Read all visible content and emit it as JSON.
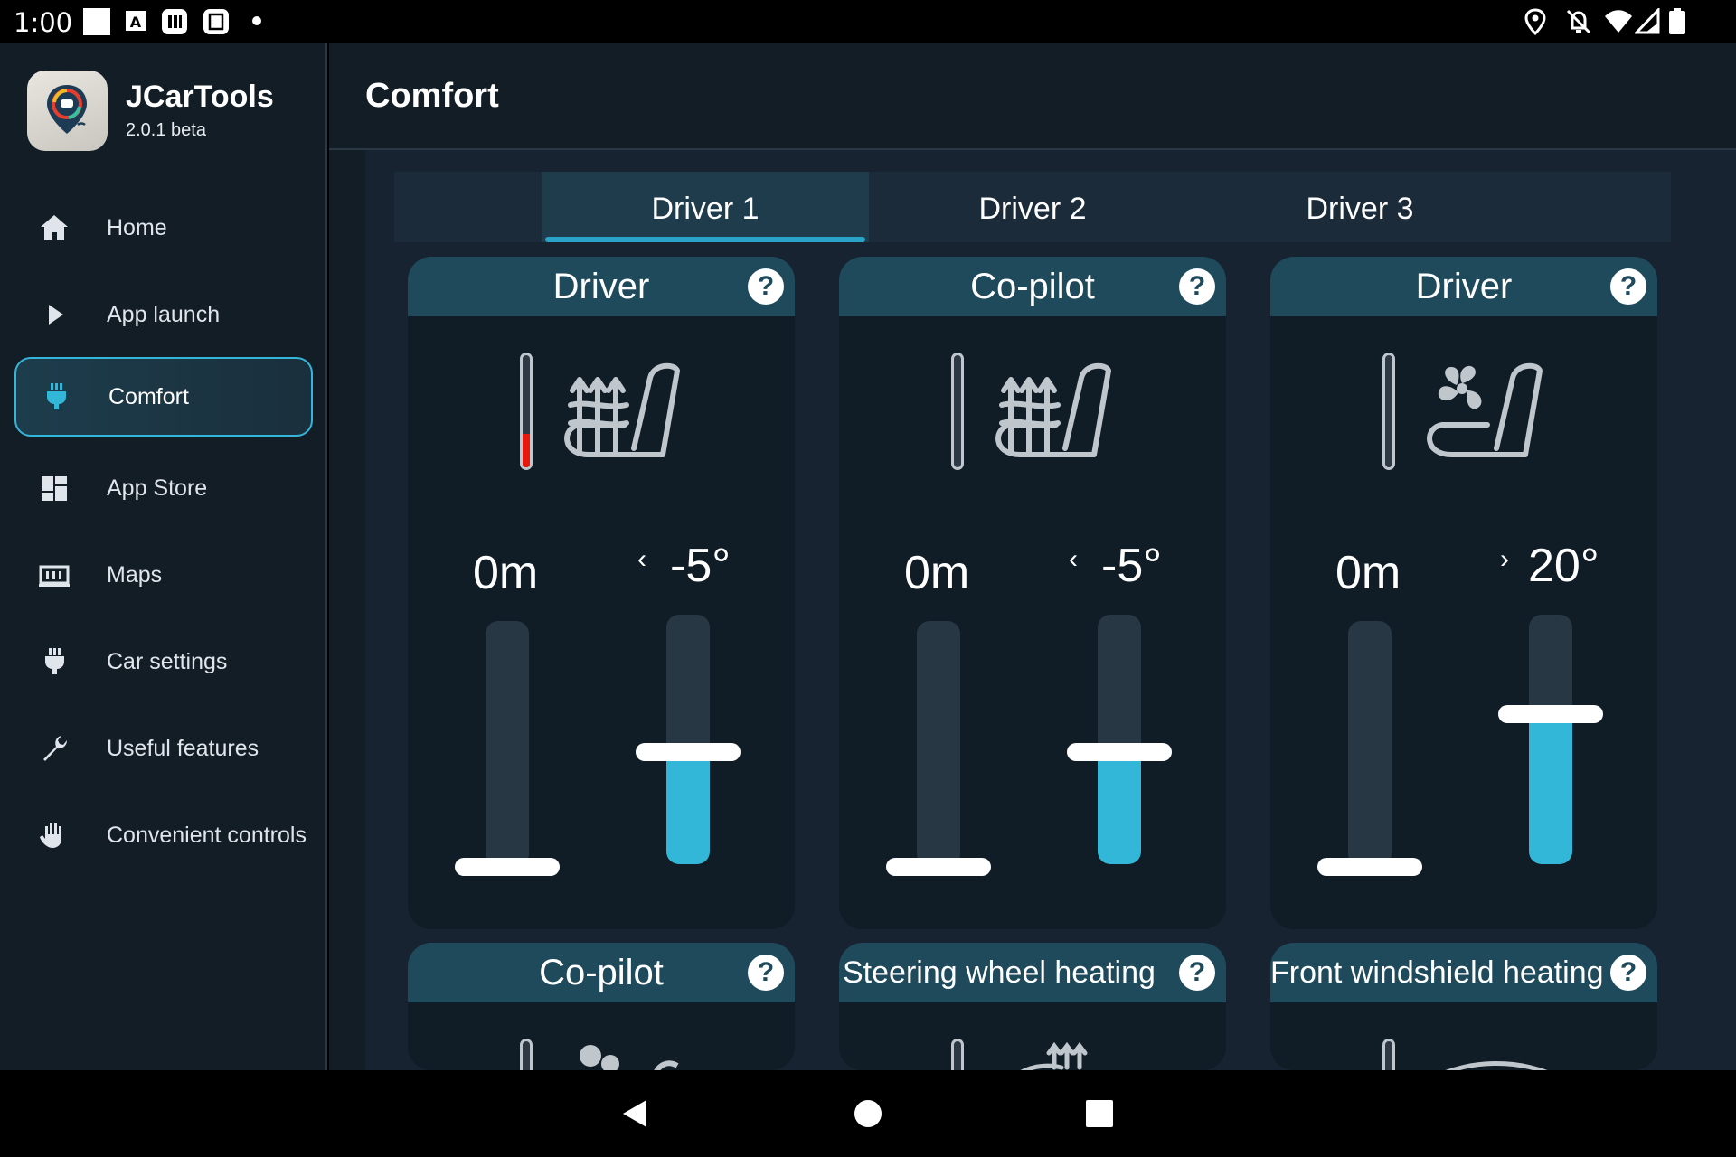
{
  "status_bar": {
    "time": "1:00",
    "left_icons": [
      "notification-square-icon",
      "keyboard-a-icon",
      "app-badge-icon",
      "app-badge-2-icon",
      "dot-icon"
    ],
    "right_icons": [
      "location-icon",
      "notifications-off-icon",
      "wifi-icon",
      "signal-icon",
      "battery-icon"
    ]
  },
  "app": {
    "name": "JCarTools",
    "version": "2.0.1 beta"
  },
  "sidebar": {
    "items": [
      {
        "label": "Home",
        "icon": "home-icon",
        "active": false
      },
      {
        "label": "App launch",
        "icon": "play-icon",
        "active": false
      },
      {
        "label": "Comfort",
        "icon": "seat-plug-icon",
        "active": true
      },
      {
        "label": "App Store",
        "icon": "dashboard-icon",
        "active": false
      },
      {
        "label": "Maps",
        "icon": "map-icon",
        "active": false
      },
      {
        "label": "Car settings",
        "icon": "plug-icon",
        "active": false
      },
      {
        "label": "Useful features",
        "icon": "wrench-icon",
        "active": false
      },
      {
        "label": "Convenient controls",
        "icon": "hand-icon",
        "active": false
      }
    ]
  },
  "header": {
    "title": "Comfort"
  },
  "tabs": [
    {
      "label": "Driver 1",
      "active": true
    },
    {
      "label": "Driver 2",
      "active": false
    },
    {
      "label": "Driver 3",
      "active": false
    }
  ],
  "cards": [
    {
      "title": "Driver",
      "help": "?",
      "icon": "seat-heating-icon",
      "thermo_level": 0.3,
      "timer": "0m",
      "temp": "-5°",
      "chevron": "‹",
      "timer_level": 0.0,
      "temp_level": 0.45
    },
    {
      "title": "Co-pilot",
      "help": "?",
      "icon": "seat-heating-icon",
      "thermo_level": 0.0,
      "timer": "0m",
      "temp": "-5°",
      "chevron": "‹",
      "timer_level": 0.0,
      "temp_level": 0.45
    },
    {
      "title": "Driver",
      "help": "?",
      "icon": "seat-ventilation-icon",
      "thermo_level": 0.0,
      "timer": "0m",
      "temp": "20°",
      "chevron": "›",
      "timer_level": 0.0,
      "temp_level": 0.6
    }
  ],
  "cards_row2": [
    {
      "title": "Co-pilot",
      "help": "?",
      "icon": "seat-ventilation-icon"
    },
    {
      "title": "Steering wheel heating",
      "help": "?",
      "icon": "steering-heating-icon"
    },
    {
      "title": "Front windshield heating",
      "help": "?",
      "icon": "windshield-heating-icon"
    }
  ],
  "colors": {
    "accent": "#33b7d9",
    "card_header": "#1f4a5c",
    "heat": "#e8190c",
    "background": "#131d26"
  },
  "nav_bar": {
    "buttons": [
      "back-icon",
      "home-circle-icon",
      "recents-icon"
    ]
  }
}
